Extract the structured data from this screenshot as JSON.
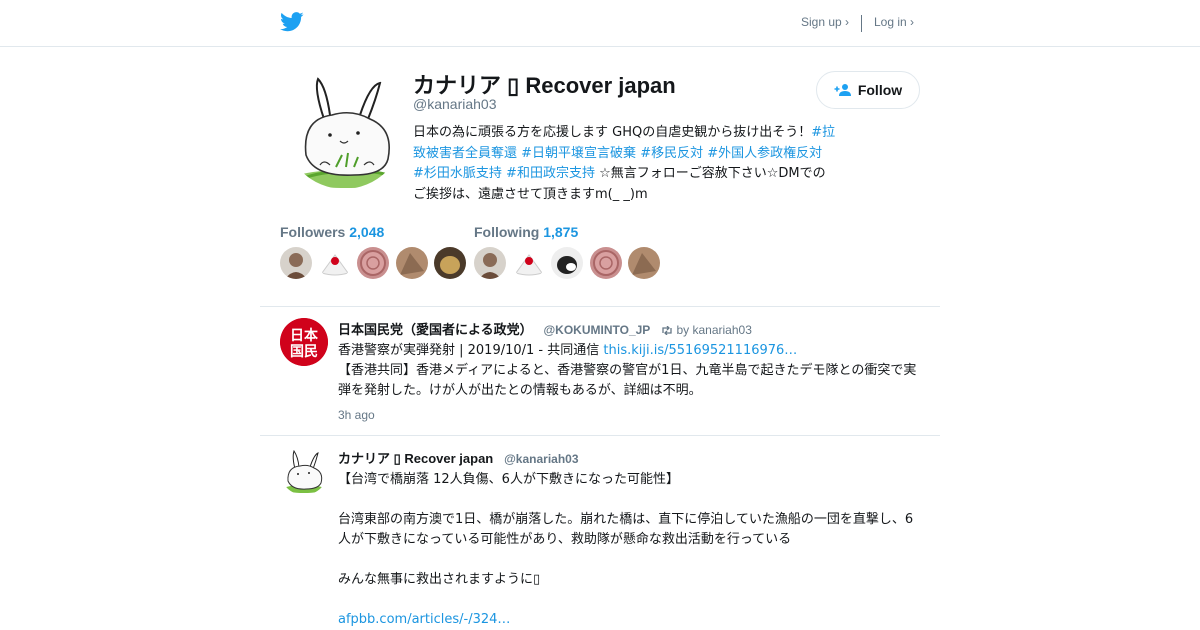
{
  "header": {
    "signup_label": "Sign up ›",
    "login_label": "Log in ›"
  },
  "profile": {
    "display_name": "カナリア ▯ Recover japan",
    "screen_name": "@kanariah03",
    "follow_label": "Follow",
    "bio": [
      {
        "text": "日本の為に頑張る方を応援します",
        "type": "text"
      },
      {
        "text": " GHQの自虐史観から抜け出そう！",
        "type": "text"
      },
      {
        "text": "#拉致被害者全員奪還",
        "type": "hashtag"
      },
      {
        "text": " ",
        "type": "text"
      },
      {
        "text": "#日朝平壌宣言破棄",
        "type": "hashtag"
      },
      {
        "text": " ",
        "type": "text"
      },
      {
        "text": "#移民反対",
        "type": "hashtag"
      },
      {
        "text": " ",
        "type": "text"
      },
      {
        "text": "#外国人参政権反対",
        "type": "hashtag"
      },
      {
        "text": " ",
        "type": "text"
      },
      {
        "text": "#杉田水脈支持",
        "type": "hashtag"
      },
      {
        "text": " ",
        "type": "text"
      },
      {
        "text": "#和田政宗支持",
        "type": "hashtag"
      },
      {
        "text": " ☆無言フォローご容赦下さい☆DMでのご挨拶は、遠慮させて頂きますm(_ _)m",
        "type": "text"
      }
    ]
  },
  "stats": {
    "followers_label": "Followers",
    "followers_count": "2,048",
    "following_label": "Following",
    "following_count": "1,875"
  },
  "tweets": [
    {
      "name": "日本国民党（愛国者による政党）",
      "handle": "@KOKUMINTO_JP",
      "retweet_by": "by kanariah03",
      "avatar_text": [
        "日本",
        "国民"
      ],
      "text_line1": "香港警察が実弾発射 | 2019/10/1 - 共同通信 ",
      "link": "this.kiji.is/55169521116976…",
      "text_line2": "【香港共同】香港メディアによると、香港警察の警官が1日、九竜半島で起きたデモ隊との衝突で実弾を発射した。けが人が出たとの情報もあるが、詳細は不明。",
      "time": "3h ago"
    },
    {
      "name": "カナリア ▯ Recover japan",
      "handle": "@kanariah03",
      "para1": "【台湾で橋崩落 12人負傷、6人が下敷きになった可能性】",
      "para2": "台湾東部の南方澳で1日、橋が崩落した。崩れた橋は、直下に停泊していた漁船の一団を直撃し、6人が下敷きになっている可能性があり、救助隊が懸命な救出活動を行っている",
      "para3": "みんな無事に救出されますように▯",
      "link": "afpbb.com/articles/-/324…"
    }
  ],
  "colors": {
    "twitter_blue": "#1da1f2",
    "link_blue": "#1b95e0",
    "muted_gray": "#657786",
    "party_red": "#d0021b"
  }
}
